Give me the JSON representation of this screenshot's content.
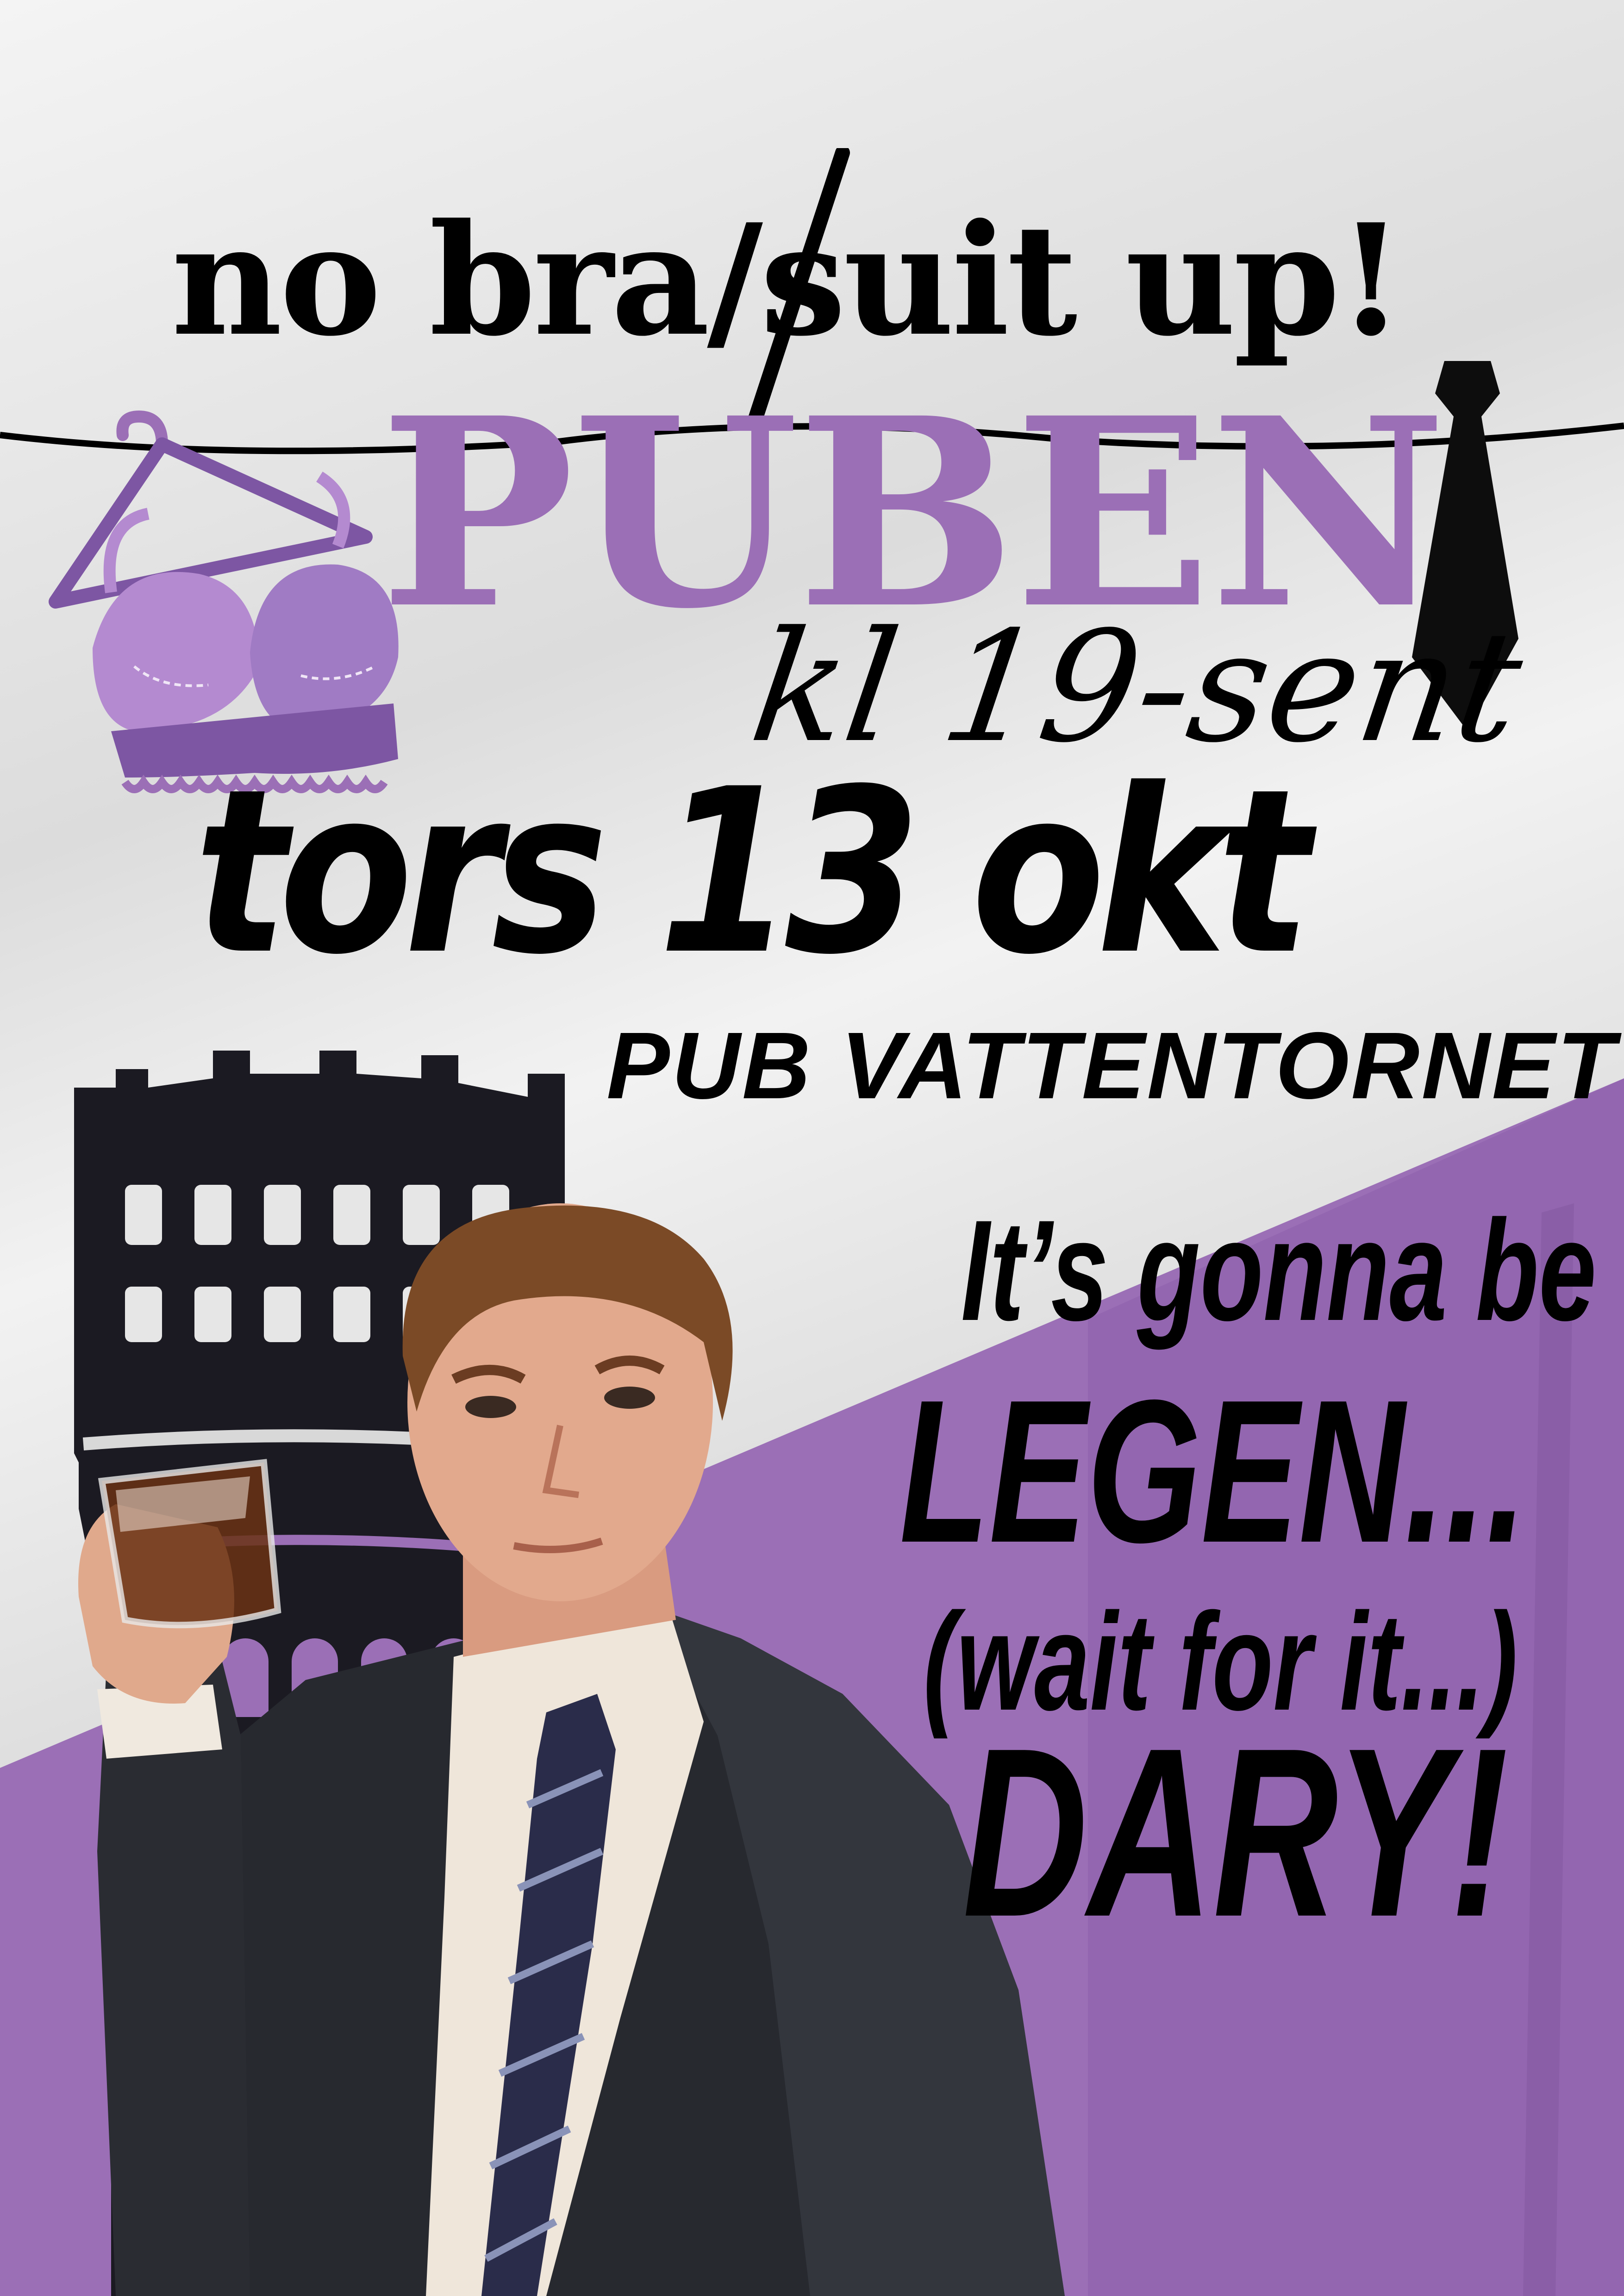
{
  "poster": {
    "headline": "no bra/suit up!",
    "venue_title": "PUBEN",
    "time": "kl 19-sent",
    "date": "tors 13 okt",
    "location": "PUB VATTENTORNET",
    "quote": {
      "line1": "It’s gonna be",
      "line2": "LEGEN...",
      "line3": "(wait for it...)",
      "line4": "DARY!"
    }
  },
  "colors": {
    "purple": "#9b6fb6",
    "purple_dark": "#7d56a3",
    "black": "#000000",
    "tower": "#1b1a22"
  },
  "icons": [
    "bra-on-hanger-icon",
    "necktie-icon",
    "water-tower-silhouette",
    "man-with-whisky-glass-photo"
  ]
}
